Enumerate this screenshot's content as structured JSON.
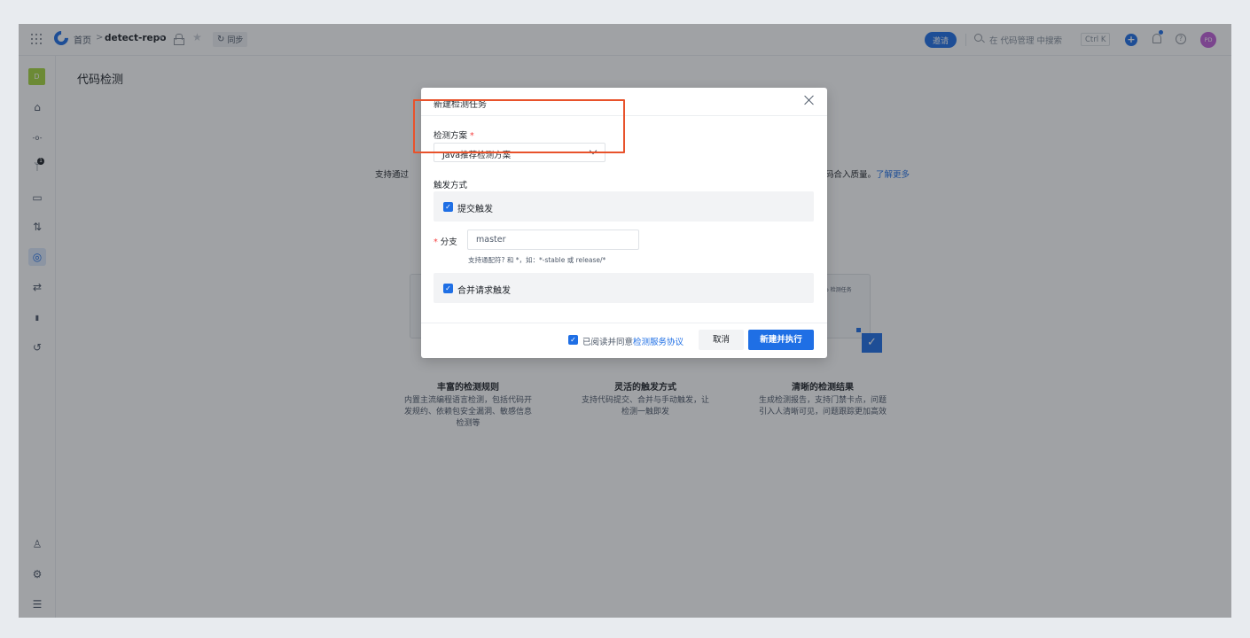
{
  "topbar": {
    "breadcrumb_home": "首页",
    "breadcrumb_sep": ">",
    "repo_name": "detect-repo",
    "sync_label": "同步",
    "invite_label": "邀请",
    "search_placeholder": "在 代码管理 中搜索",
    "search_shortcut": "Ctrl K",
    "user_initials": "PD"
  },
  "sidebar": {
    "repo_initial": "D",
    "items": [
      {
        "icon": "home-icon",
        "glyph": "⌂"
      },
      {
        "icon": "commit-icon",
        "glyph": "-o-"
      },
      {
        "icon": "branch-icon",
        "glyph": "ᛘ",
        "badge": "1"
      },
      {
        "icon": "tag-icon",
        "glyph": "▭"
      },
      {
        "icon": "merge-request-icon",
        "glyph": "⇅"
      },
      {
        "icon": "code-detection-icon",
        "glyph": "◎",
        "active": true
      },
      {
        "icon": "pipeline-icon",
        "glyph": "⇄"
      },
      {
        "icon": "stats-icon",
        "glyph": "▮"
      },
      {
        "icon": "history-icon",
        "glyph": "↺"
      }
    ],
    "bottom": [
      {
        "icon": "member-icon",
        "glyph": "♙"
      },
      {
        "icon": "settings-icon",
        "glyph": "⚙"
      },
      {
        "icon": "collapse-icon",
        "glyph": "☰"
      }
    ]
  },
  "page": {
    "title": "代码检测",
    "intro_start": "支持通过",
    "intro_end": "码合入质量。",
    "intro_link": "了解更多",
    "card_mini_title": "o 检测任务",
    "features": [
      {
        "title": "丰富的检测规则",
        "desc": "内置主流编程语言检测，包括代码开发规约、依赖包安全漏洞、敏感信息检测等"
      },
      {
        "title": "灵活的触发方式",
        "desc": "支持代码提交、合并与手动触发，让检测一触即发"
      },
      {
        "title": "清晰的检测结果",
        "desc": "生成检测报告，支持门禁卡点，问题引入人清晰可见，问题跟踪更加高效"
      }
    ]
  },
  "modal": {
    "title": "新建检测任务",
    "scheme_label": "检测方案",
    "required_mark": "*",
    "scheme_value": "Java推荐检测方案",
    "trigger_label": "触发方式",
    "commit_trigger_label": "提交触发",
    "branch_label": "分支",
    "branch_value": "master",
    "branch_hint": "支持通配符? 和 *，如：*-stable 或 release/*",
    "mr_trigger_label": "合并请求触发",
    "agree_text": "已阅读并同意",
    "agree_link": "检测服务协议",
    "cancel_label": "取消",
    "submit_label": "新建并执行"
  },
  "colors": {
    "accent": "#1f6fe5",
    "highlight": "#e8522b",
    "overlay": "rgba(29,33,41,0.42)"
  }
}
